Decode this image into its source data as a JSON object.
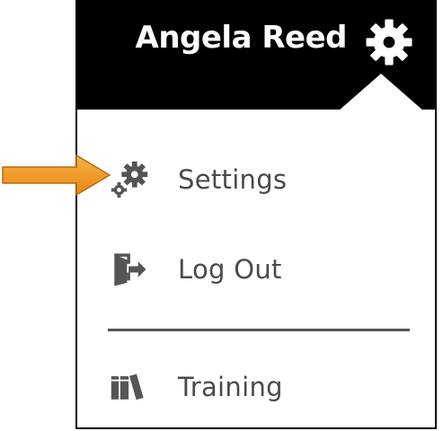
{
  "header": {
    "user_name": "Angela Reed",
    "gear_icon": "gear-icon"
  },
  "menu": {
    "items": [
      {
        "label": "Settings",
        "icon": "settings-gears-icon"
      },
      {
        "label": "Log Out",
        "icon": "logout-door-icon"
      },
      {
        "label": "Training",
        "icon": "books-icon"
      }
    ]
  },
  "annotation": {
    "arrow_icon": "orange-arrow-icon",
    "arrow_color": "#F39A1E"
  },
  "colors": {
    "header_bg": "#000000",
    "item_text": "#4a4a4a",
    "icon_color": "#555555"
  }
}
